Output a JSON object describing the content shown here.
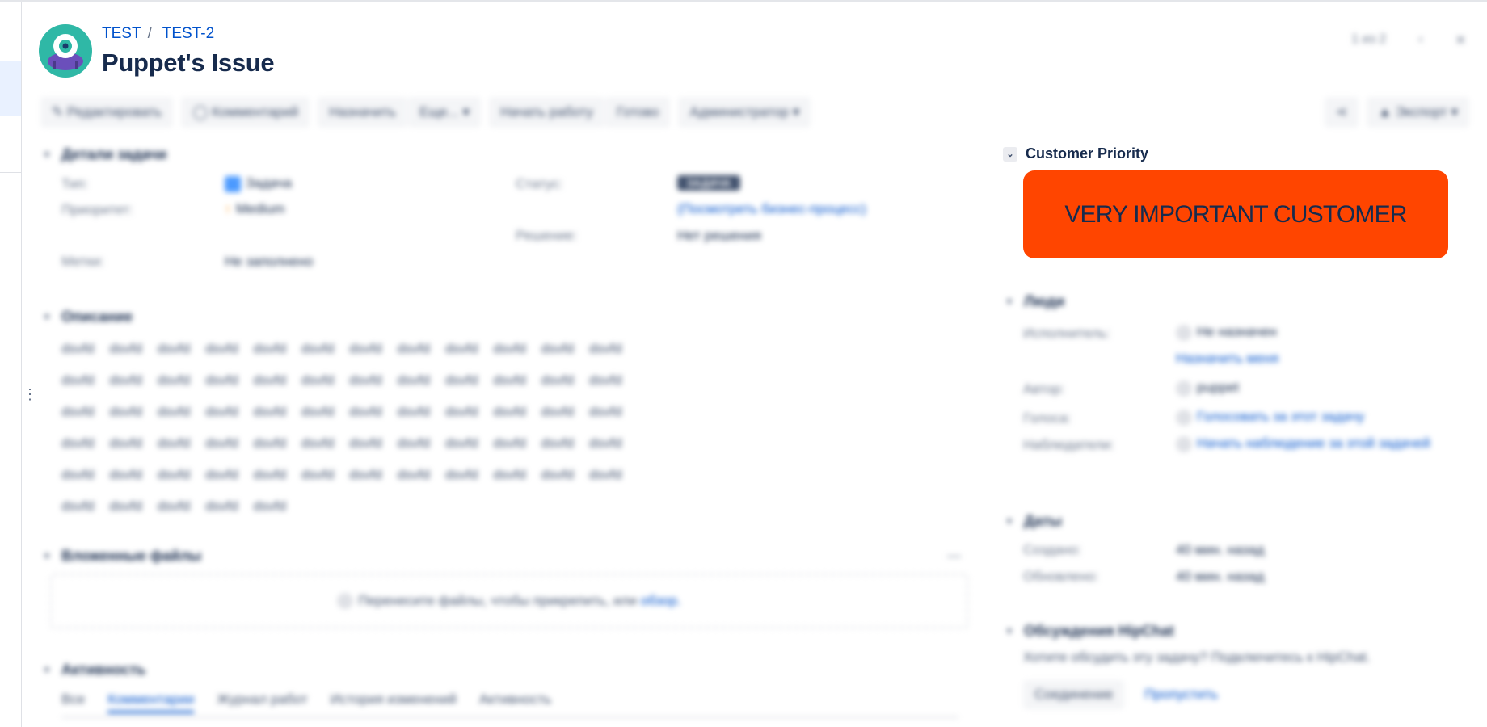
{
  "breadcrumb": {
    "project": "TEST",
    "issue_key": "TEST-2"
  },
  "issue": {
    "title": "Puppet's Issue"
  },
  "topnav": {
    "counter": "1 из 2"
  },
  "toolbar": {
    "edit": "Редактировать",
    "comment": "Комментарий",
    "assign": "Назначить",
    "more": "Еще...",
    "start_work": "Начать работу",
    "done": "Готово",
    "admin": "Администратор",
    "export": "Экспорт"
  },
  "details": {
    "heading": "Детали задачи",
    "type_label": "Тип:",
    "type_value": "Задача",
    "priority_label": "Приоритет:",
    "priority_value": "Medium",
    "labels_label": "Метки:",
    "labels_value": "Не заполнено",
    "status_label": "Статус:",
    "status_value": "ЗАДАЧА",
    "workflow_link": "(Посмотреть бизнес-процесс)",
    "resolution_label": "Решение:",
    "resolution_value": "Нет решения"
  },
  "description": {
    "heading": "Описание",
    "text": "dsvfd dsvfd dsvfd dsvfd dsvfd dsvfd dsvfd dsvfd dsvfd dsvfd dsvfd dsvfd dsvfd dsvfd dsvfd dsvfd dsvfd dsvfd dsvfd dsvfd dsvfd dsvfd dsvfd dsvfd dsvfd dsvfd dsvfd dsvfd dsvfd dsvfd dsvfd dsvfd dsvfd dsvfd dsvfd dsvfd dsvfd dsvfd dsvfd dsvfd dsvfd dsvfd dsvfd dsvfd dsvfd dsvfd dsvfd dsvfd dsvfd dsvfd dsvfd dsvfd dsvfd dsvfd dsvfd dsvfd dsvfd dsvfd dsvfd dsvfd dsvfd dsvfd dsvfd dsvfd dsvfd"
  },
  "attachments": {
    "heading": "Вложенные файлы",
    "drop_text": "Перенесите файлы, чтобы прикрепить, или",
    "browse_link": "обзор."
  },
  "activity": {
    "heading": "Активность",
    "tabs": [
      "Все",
      "Комментарии",
      "Журнал работ",
      "История изменений",
      "Активность"
    ]
  },
  "customer_priority": {
    "heading": "Customer Priority",
    "banner": "VERY IMPORTANT CUSTOMER",
    "banner_color": "#ff4500"
  },
  "people": {
    "heading": "Люди",
    "assignee_label": "Исполнитель:",
    "assignee_value": "Не назначен",
    "assign_me_link": "Назначить меня",
    "reporter_label": "Автор:",
    "reporter_value": "puppet",
    "votes_label": "Голоса:",
    "votes_link": "Голосовать за этот задачу",
    "watchers_label": "Наблюдатели:",
    "watchers_link": "Начать наблюдение за этой задачей"
  },
  "dates": {
    "heading": "Даты",
    "created_label": "Создано:",
    "created_value": "40 мин. назад",
    "updated_label": "Обновлено:",
    "updated_value": "40 мин. назад"
  },
  "hipchat": {
    "heading": "Обсуждения HipChat",
    "text": "Хотите обсудить эту задачу? Подключитесь к HipChat.",
    "connect_button": "Соединение",
    "dismiss_link": "Пропустить"
  },
  "colors": {
    "link": "#0052cc",
    "text": "#172b4d",
    "muted": "#6b778c"
  }
}
